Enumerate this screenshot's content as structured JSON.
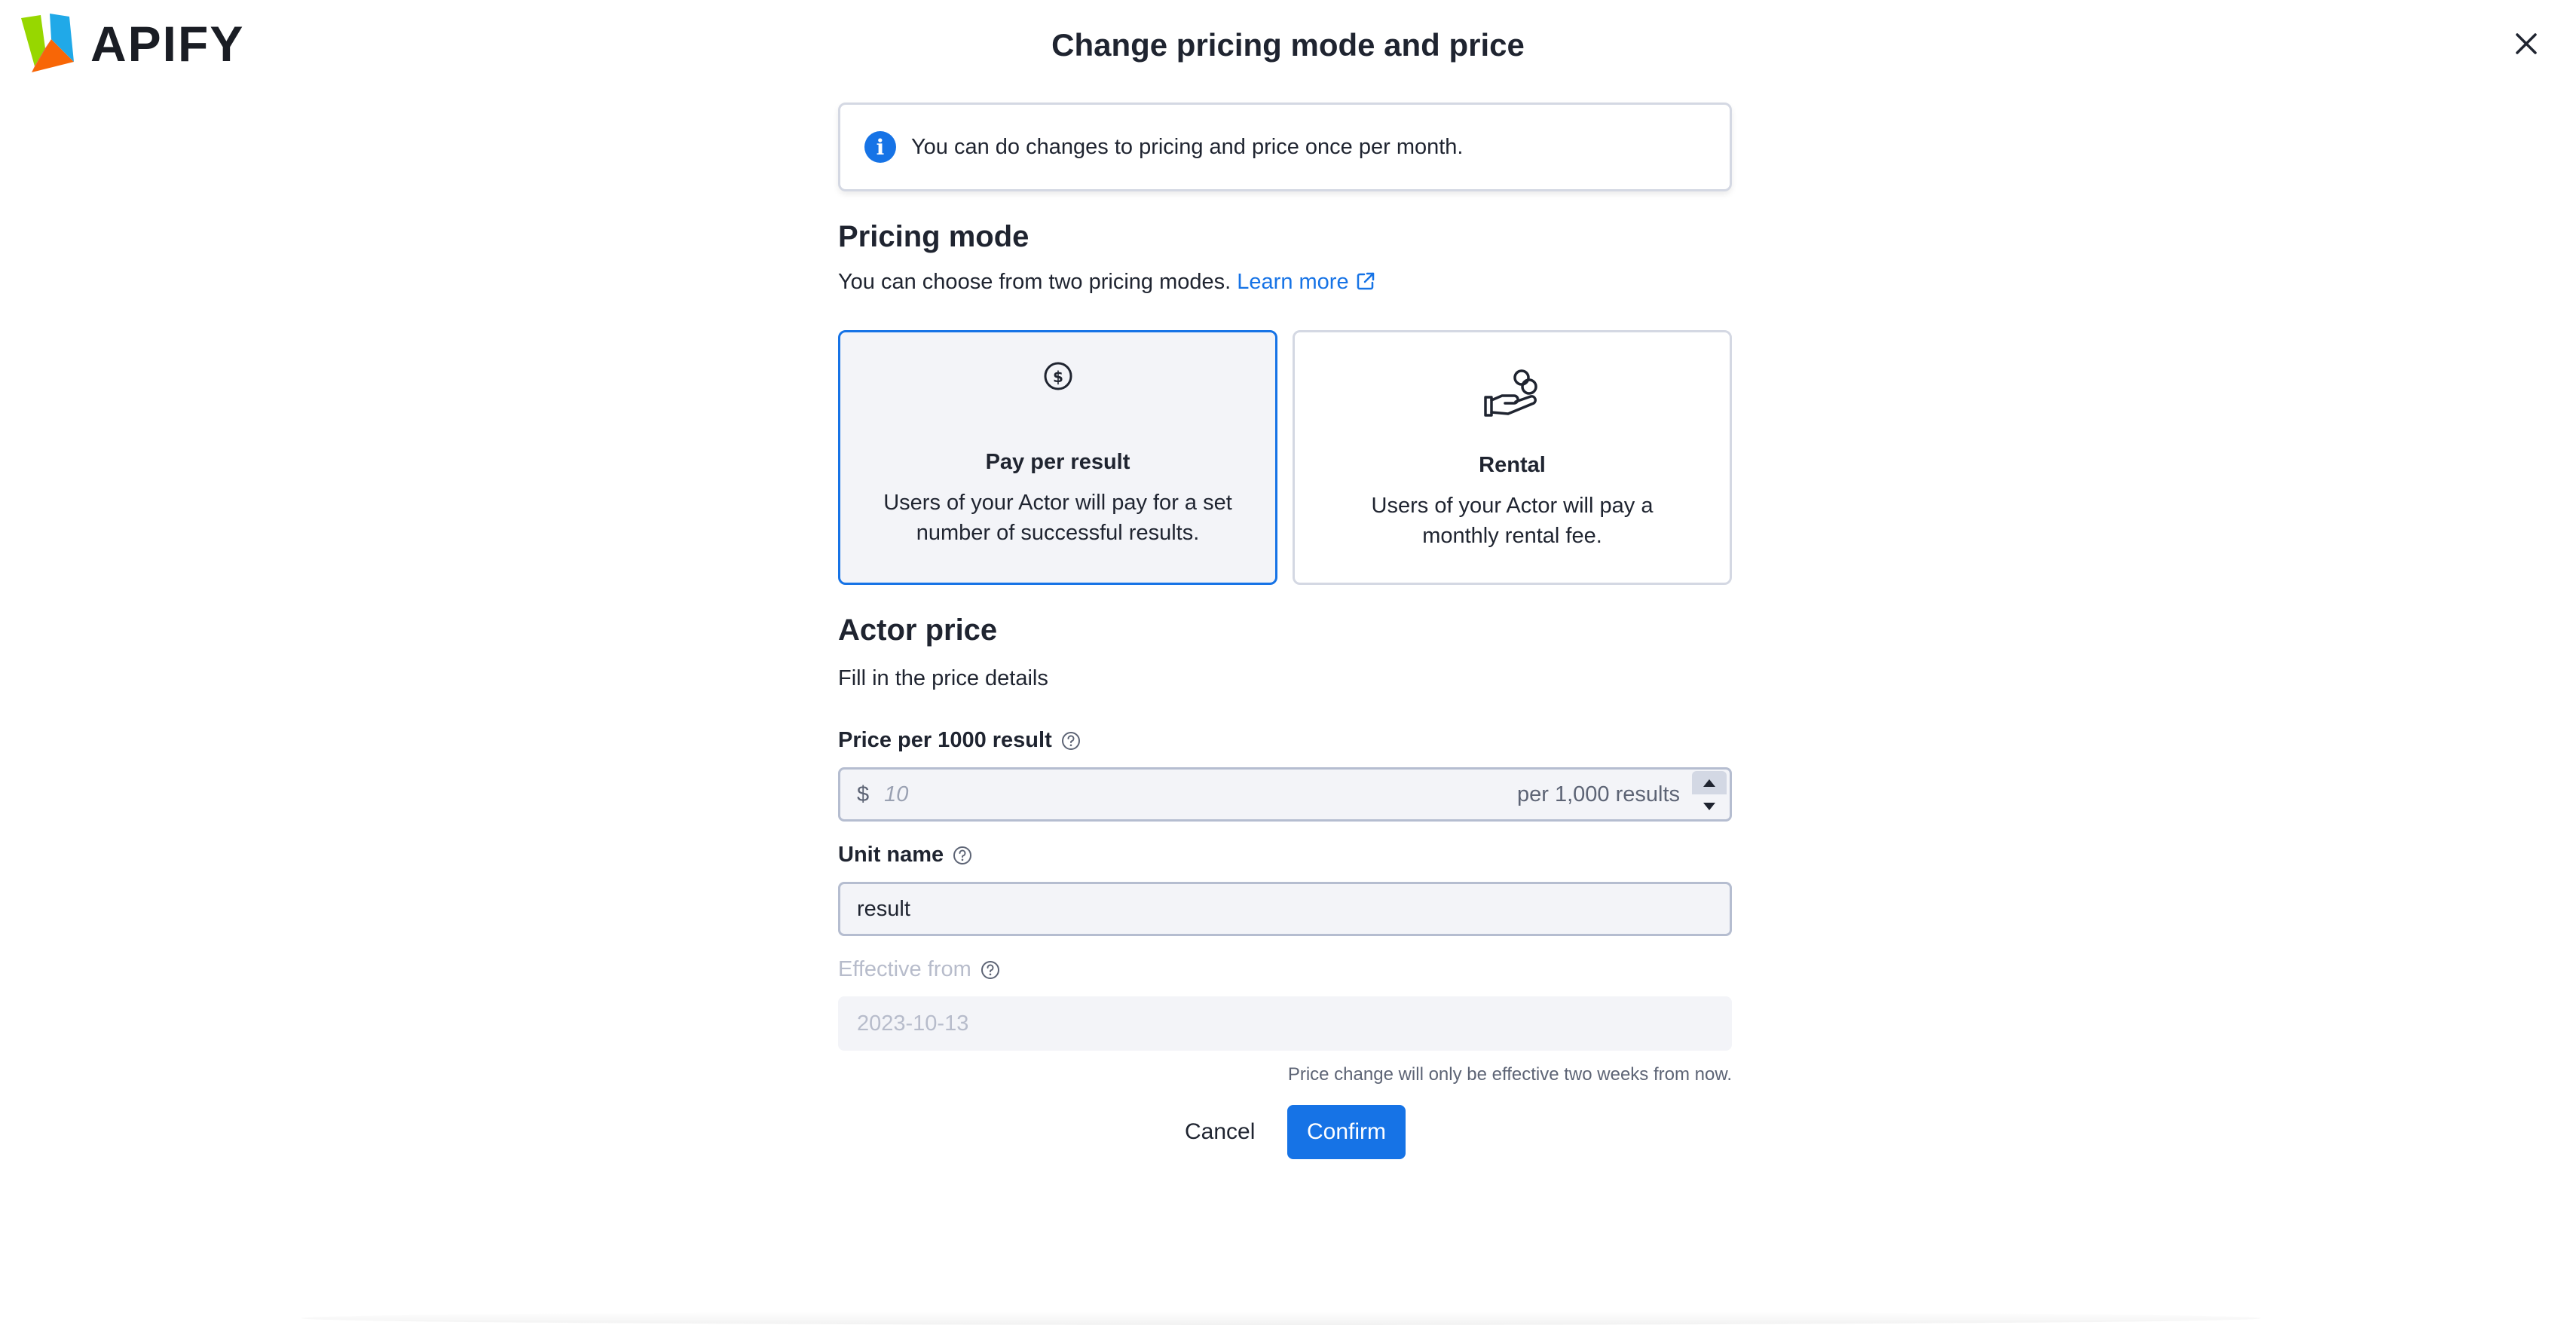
{
  "brand": {
    "name": "APIFY",
    "logo_icon": "apify-logo-icon"
  },
  "dialog": {
    "title": "Change pricing mode and price",
    "close_icon": "close-icon"
  },
  "info": {
    "text": "You can do changes to pricing and price once per month."
  },
  "pricing_mode": {
    "title": "Pricing mode",
    "subtitle": "You can choose from two pricing modes.",
    "learn_more": "Learn more",
    "options": [
      {
        "title": "Pay per result",
        "description": "Users of your Actor will pay for a set number of successful results.",
        "icon": "dollar-coin-icon",
        "selected": true
      },
      {
        "title": "Rental",
        "description": "Users of your Actor will pay a monthly rental fee.",
        "icon": "hand-coins-icon",
        "selected": false
      }
    ]
  },
  "actor_price": {
    "title": "Actor price",
    "subtitle": "Fill in the price details",
    "price_field": {
      "label": "Price per 1000 result",
      "currency": "$",
      "placeholder": "10",
      "suffix": "per 1,000 results"
    },
    "unit_field": {
      "label": "Unit name",
      "value": "result"
    },
    "effective_field": {
      "label": "Effective from",
      "value": "2023-10-13",
      "note": "Price change will only be effective two weeks from now."
    }
  },
  "actions": {
    "cancel": "Cancel",
    "confirm": "Confirm"
  },
  "colors": {
    "accent": "#1673e6",
    "border": "#d4d8e3",
    "field_bg": "#f3f4f8"
  }
}
